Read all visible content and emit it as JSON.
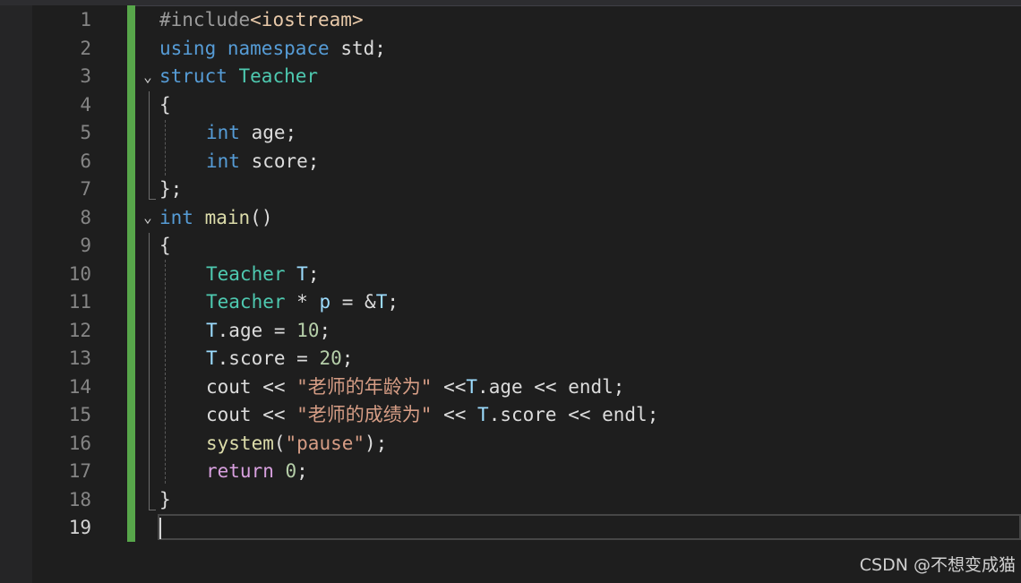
{
  "editor": {
    "line_numbers": [
      "1",
      "2",
      "3",
      "4",
      "5",
      "6",
      "7",
      "8",
      "9",
      "10",
      "11",
      "12",
      "13",
      "14",
      "15",
      "16",
      "17",
      "18",
      "19"
    ],
    "active_line": "19",
    "lines": {
      "l1": {
        "a": "#include",
        "b": "<iostream>"
      },
      "l2": {
        "a": "using",
        "b": " ",
        "c": "namespace",
        "d": " std;"
      },
      "l3": {
        "a": "struct",
        "b": " ",
        "c": "Teacher"
      },
      "l4": {
        "a": "{"
      },
      "l5": {
        "a": "int",
        "b": " age;"
      },
      "l6": {
        "a": "int",
        "b": " score;"
      },
      "l7": {
        "a": "};"
      },
      "l8": {
        "a": "int",
        "b": " ",
        "c": "main",
        "d": "()"
      },
      "l9": {
        "a": "{"
      },
      "l10": {
        "a": "Teacher",
        "b": " ",
        "c": "T",
        "d": ";"
      },
      "l11": {
        "a": "Teacher",
        "b": " * ",
        "c": "p",
        "d": " = &",
        "e": "T",
        "f": ";"
      },
      "l12": {
        "a": "T",
        "b": ".age = ",
        "c": "10",
        "d": ";"
      },
      "l13": {
        "a": "T",
        "b": ".score = ",
        "c": "20",
        "d": ";"
      },
      "l14": {
        "a": "cout << ",
        "b": "\"老师的年龄为\"",
        "c": " <<",
        "d": "T",
        "e": ".age << endl;"
      },
      "l15": {
        "a": "cout << ",
        "b": "\"老师的成绩为\"",
        "c": " << ",
        "d": "T",
        "e": ".score << endl;"
      },
      "l16": {
        "a": "system",
        "b": "(",
        "c": "\"pause\"",
        "d": ");"
      },
      "l17": {
        "a": "return",
        "b": " ",
        "c": "0",
        "d": ";"
      },
      "l18": {
        "a": "}"
      },
      "l19": {
        "a": ""
      }
    },
    "fold_icon": "chevron-down-icon"
  },
  "watermark": "CSDN @不想变成猫"
}
